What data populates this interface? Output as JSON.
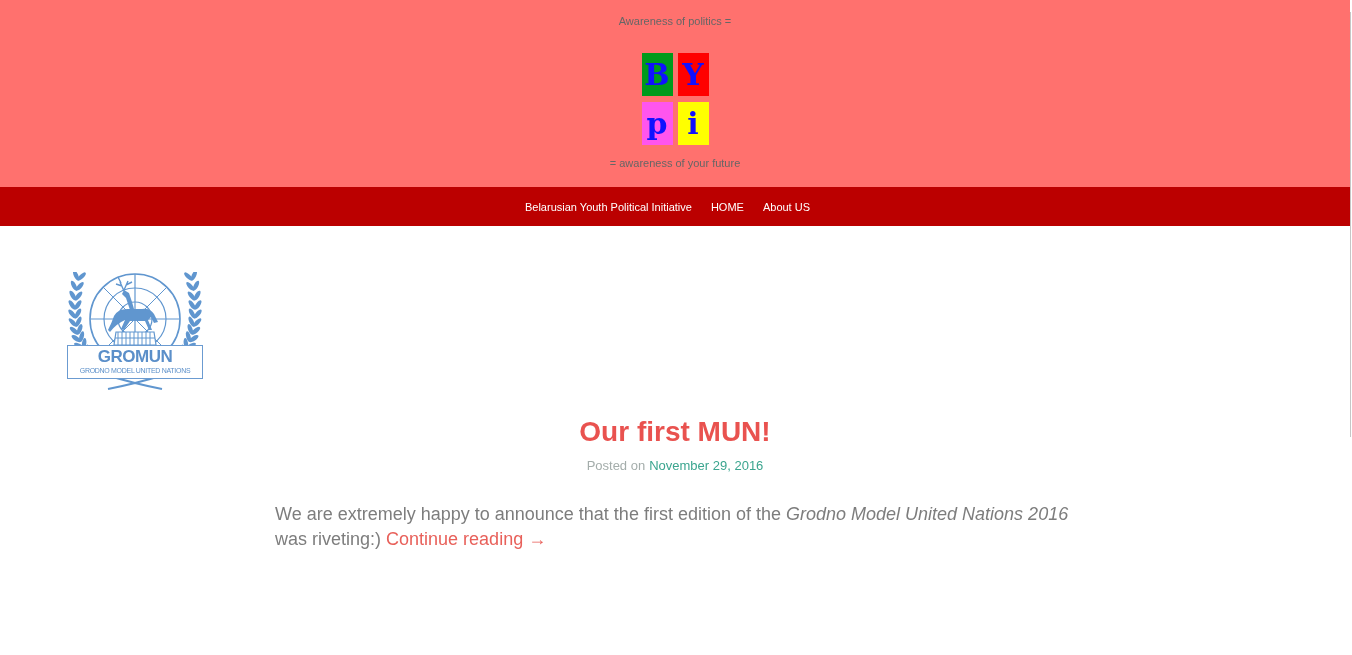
{
  "header": {
    "tagline_top": "Awareness of politics =",
    "logo_tiles": [
      {
        "letter": "B",
        "color": "#009a1c"
      },
      {
        "letter": "Y",
        "color": "#ff0000"
      },
      {
        "letter": "p",
        "color": "#ff55ee"
      },
      {
        "letter": "i",
        "color": "#ffff00"
      }
    ],
    "tagline_bottom": "= awareness of your future"
  },
  "nav": {
    "items": [
      "Belarusian Youth Political Initiative",
      "HOME",
      "About US"
    ]
  },
  "emblem": {
    "title": "GROMUN",
    "subtitle": "GRODNO MODEL UNITED NATIONS"
  },
  "post": {
    "title": "Our first MUN!",
    "meta_prefix": "Posted on",
    "date": "November 29, 2016",
    "excerpt": "We are extremely happy to announce that the first edition of the *Grodno Model United Nations 2016* was riveting:)",
    "more_link": "Continue reading →"
  }
}
